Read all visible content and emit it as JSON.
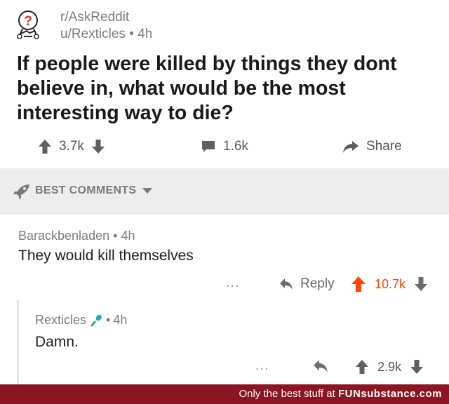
{
  "post": {
    "subreddit": "r/AskReddit",
    "author": "u/Rexticles",
    "age": "4h",
    "title": "If people were killed by things they dont believe in, what would be the most interesting way to die?",
    "upvotes": "3.7k",
    "comments": "1.6k",
    "share_label": "Share"
  },
  "sort": {
    "label": "BEST COMMENTS"
  },
  "comments": [
    {
      "author": "Barackbenladen",
      "age": "4h",
      "body": "They would kill themselves",
      "reply_label": "Reply",
      "score": "10.7k",
      "more": "..."
    },
    {
      "author": "Rexticles",
      "age": "4h",
      "body": "Damn.",
      "score": "2.9k",
      "more": "..."
    }
  ],
  "footer": {
    "tagline": "Only the best stuff at",
    "brand": "FUNsubstance.com"
  },
  "colors": {
    "upvote_active": "#ff4500",
    "footer_bg": "#8b1622"
  },
  "icons": [
    "askreddit-icon",
    "upvote-arrow-icon",
    "downvote-arrow-icon",
    "comment-icon",
    "share-icon",
    "rocket-icon",
    "chevron-down-icon",
    "reply-icon",
    "microphone-icon"
  ]
}
